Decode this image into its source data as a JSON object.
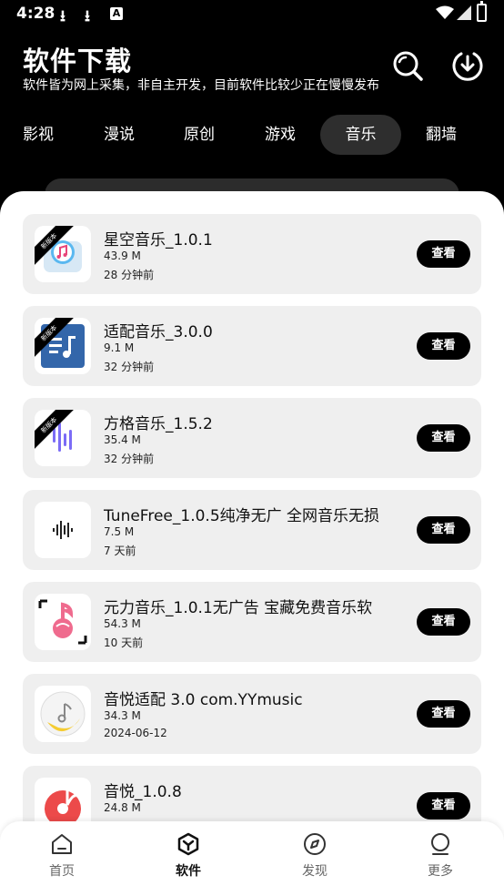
{
  "status_bar": {
    "time": "4:28",
    "badge": "A"
  },
  "header": {
    "title": "软件下载",
    "subtitle": "软件皆为网上采集，非自主开发，目前软件比较少正在慢慢发布"
  },
  "tabs": [
    {
      "label": "影视"
    },
    {
      "label": "漫说"
    },
    {
      "label": "原创"
    },
    {
      "label": "游戏"
    },
    {
      "label": "音乐",
      "active": true
    },
    {
      "label": "翻墙"
    }
  ],
  "items": [
    {
      "name": "星空音乐_1.0.1",
      "size": "43.9 M",
      "time": "28 分钟前",
      "badge": "新版本",
      "icon": "itunes-music-icon"
    },
    {
      "name": "适配音乐_3.0.0",
      "size": "9.1 M",
      "time": "32 分钟前",
      "badge": "新版本",
      "icon": "playlist-icon"
    },
    {
      "name": "方格音乐_1.5.2",
      "size": "35.4 M",
      "time": "32 分钟前",
      "badge": "新版本",
      "icon": "sound-bars-icon"
    },
    {
      "name": "TuneFree_1.0.5纯净无广 全网音乐无损",
      "size": "7.5 M",
      "time": "7 天前",
      "badge": "",
      "icon": "waveform-icon"
    },
    {
      "name": "元力音乐_1.0.1无广告 宝藏免费音乐软",
      "size": "54.3 M",
      "time": "10 天前",
      "badge": "",
      "icon": "pink-note-icon"
    },
    {
      "name": "音悦适配 3.0 com.YYmusic",
      "size": "34.3 M",
      "time": "2024-06-12",
      "badge": "",
      "icon": "moon-note-icon"
    },
    {
      "name": "音悦_1.0.8",
      "size": "24.8 M",
      "time": "",
      "badge": "",
      "icon": "red-disc-icon"
    }
  ],
  "view_label": "查看",
  "bottom_nav": [
    {
      "label": "首页",
      "icon": "home-icon"
    },
    {
      "label": "软件",
      "icon": "apps-icon",
      "active": true
    },
    {
      "label": "发现",
      "icon": "compass-icon"
    },
    {
      "label": "更多",
      "icon": "profile-icon"
    }
  ]
}
